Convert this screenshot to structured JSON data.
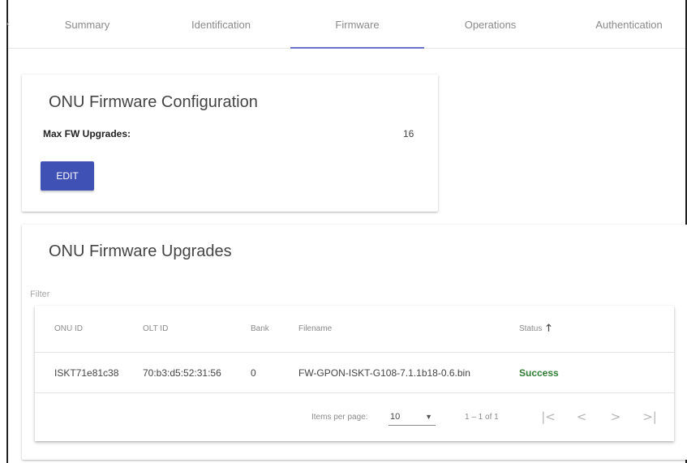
{
  "tabs": [
    {
      "label": "Summary"
    },
    {
      "label": "Identification"
    },
    {
      "label": "Firmware"
    },
    {
      "label": "Operations"
    },
    {
      "label": "Authentication"
    }
  ],
  "active_tab": "Firmware",
  "config_card": {
    "title": "ONU Firmware Configuration",
    "max_fw_label": "Max FW Upgrades:",
    "max_fw_value": "16",
    "edit_label": "EDIT"
  },
  "upgrades_card": {
    "title": "ONU Firmware Upgrades",
    "filter_placeholder": "Filter",
    "columns": [
      "ONU ID",
      "OLT ID",
      "Bank",
      "Filename",
      "Status"
    ],
    "sort_icon": "arrow-up-icon",
    "rows": [
      {
        "onu_id": "ISKT71e81c38",
        "olt_id": "70:b3:d5:52:31:56",
        "bank": "0",
        "filename": "FW-GPON-ISKT-G108-7.1.1b18-0.6.bin",
        "status": "Success"
      }
    ],
    "paginator": {
      "items_per_page_label": "Items per page:",
      "items_per_page_value": "10",
      "range_label": "1 – 1 of 1"
    }
  },
  "colors": {
    "accent": "#3f51b5",
    "tab_underline": "#6b72c9",
    "success": "#2e7d32"
  }
}
